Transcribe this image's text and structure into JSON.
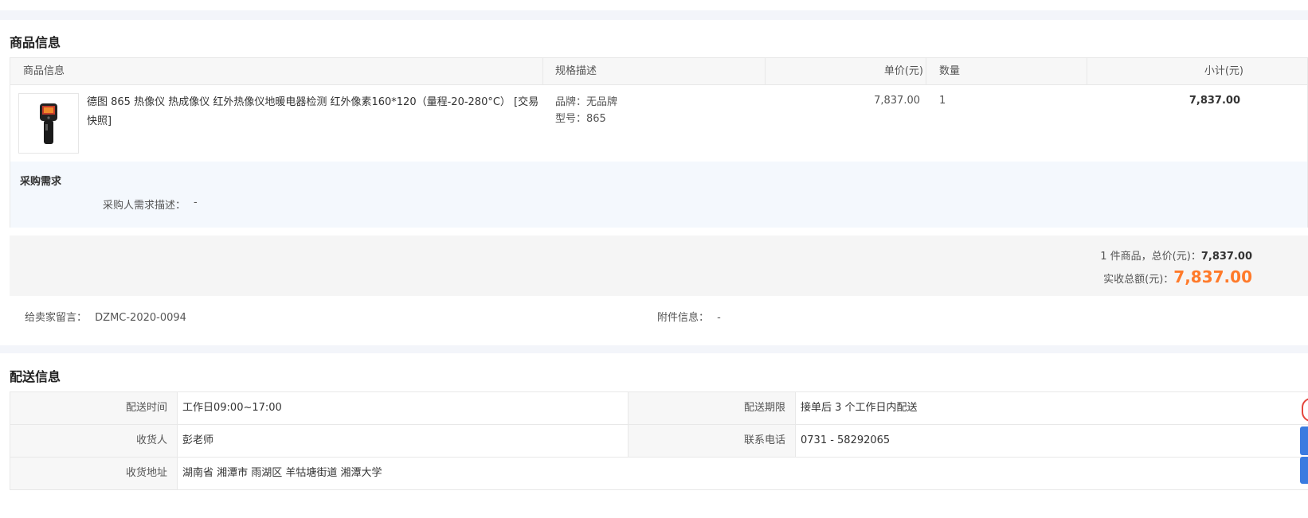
{
  "product_section": {
    "title": "商品信息",
    "columns": [
      "商品信息",
      "规格描述",
      "单价(元)",
      "数量",
      "小计(元)"
    ],
    "item": {
      "name": "德图 865 热像仪 热成像仪 红外热像仪地暖电器检测 红外像素160*120（量程-20-280°C） [交易快照]",
      "spec_brand": "品牌：无品牌",
      "spec_model": "型号：865",
      "unit_price": "7,837.00",
      "quantity": "1",
      "subtotal": "7,837.00"
    },
    "requirement": {
      "title": "采购需求",
      "label": "采购人需求描述：",
      "value": "-"
    },
    "summary": {
      "count_text": "1 件商品，总价(元)：",
      "total": "7,837.00",
      "actual_label": "实收总额(元)：",
      "actual_total": "7,837.00"
    },
    "note": {
      "seller_label": "给卖家留言：",
      "seller_value": "DZMC-2020-0094",
      "attach_label": "附件信息：",
      "attach_value": "-"
    }
  },
  "delivery_section": {
    "title": "配送信息",
    "rows": [
      {
        "label1": "配送时间",
        "value1": "工作日09:00~17:00",
        "label2": "配送期限",
        "value2": "接单后 3 个工作日内配送"
      },
      {
        "label1": "收货人",
        "value1": "彭老师",
        "label2": "联系电话",
        "value2": "0731 - 58292065"
      },
      {
        "label1": "收货地址",
        "value1": "湖南省 湘潭市 雨湖区 羊牯塘街道 湘潭大学"
      }
    ]
  },
  "colors": {
    "accent_price": "#ff7a2a",
    "band": "#f3f5fa",
    "requirement_bg": "#f4f8fd"
  }
}
